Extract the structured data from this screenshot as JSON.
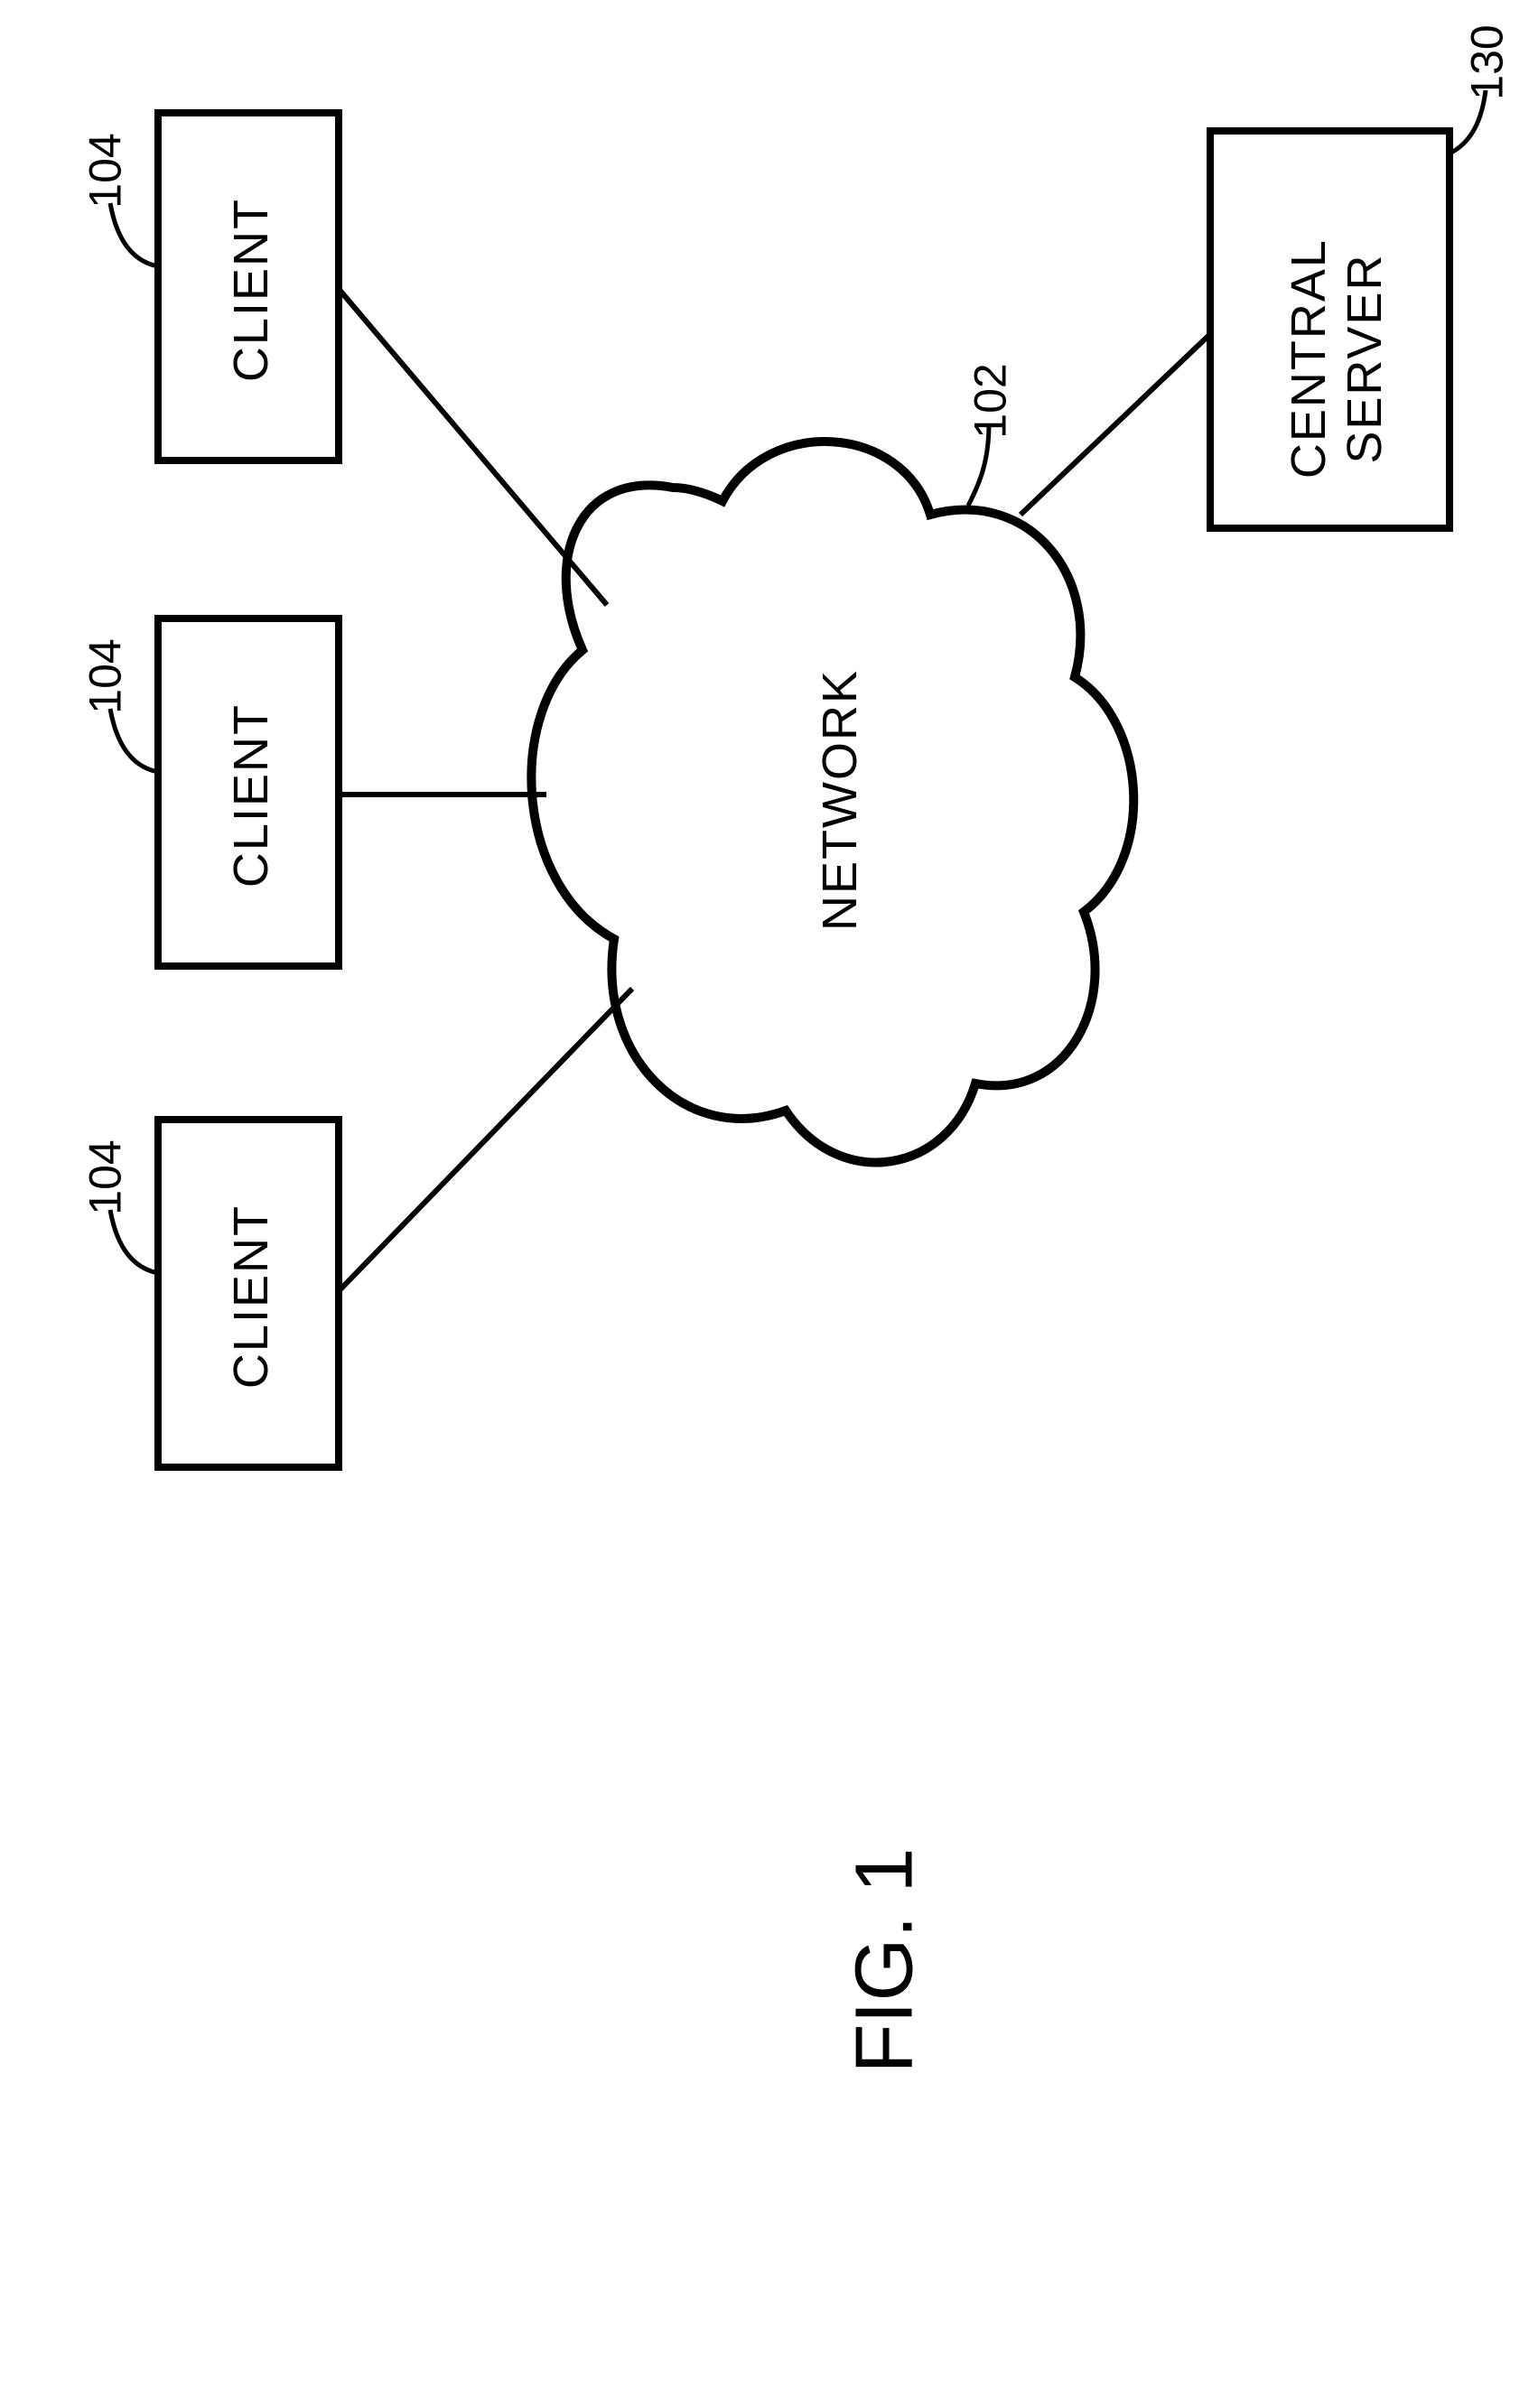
{
  "nodes": {
    "client1": {
      "label": "CLIENT",
      "ref": "104"
    },
    "client2": {
      "label": "CLIENT",
      "ref": "104"
    },
    "client3": {
      "label": "CLIENT",
      "ref": "104"
    },
    "network": {
      "label": "NETWORK",
      "ref": "102"
    },
    "server": {
      "label": "CENTRAL\nSERVER",
      "ref": "130"
    }
  },
  "figure_caption": "FIG. 1"
}
